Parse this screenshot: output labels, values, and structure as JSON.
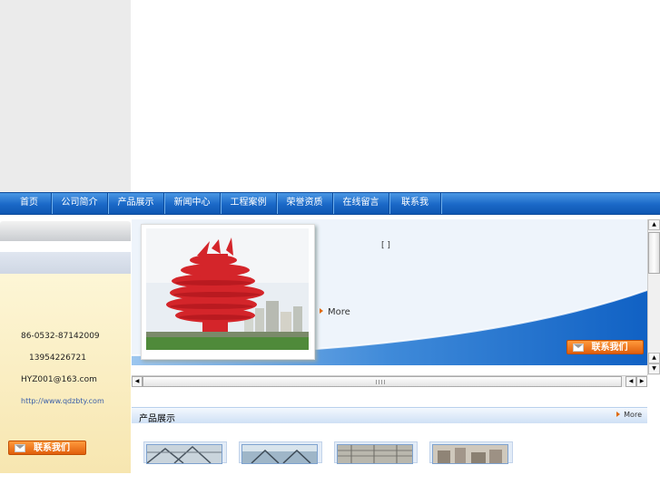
{
  "nav": {
    "items": [
      {
        "label": "首页"
      },
      {
        "label": "公司简介"
      },
      {
        "label": "产品展示"
      },
      {
        "label": "新闻中心"
      },
      {
        "label": "工程案例"
      },
      {
        "label": "荣誉资质"
      },
      {
        "label": "在线留言"
      },
      {
        "label": "联系我"
      }
    ]
  },
  "contact": {
    "phone": "86-0532-87142009",
    "mobile": "13954226721",
    "email": "HYZ001@163.com",
    "website": "http://www.qdzbty.com",
    "button_label": "联系我们"
  },
  "banner": {
    "bracket_text": "[ ]",
    "more_label": "More",
    "contact_button_label": "联系我们"
  },
  "products_section": {
    "title": "产品展示",
    "more_label": "More"
  },
  "colors": {
    "nav_blue": "#1a68c7",
    "accent_orange": "#e05f0c",
    "banner_blue": "#1565c8",
    "panel_cream": "#fdf6d6"
  }
}
